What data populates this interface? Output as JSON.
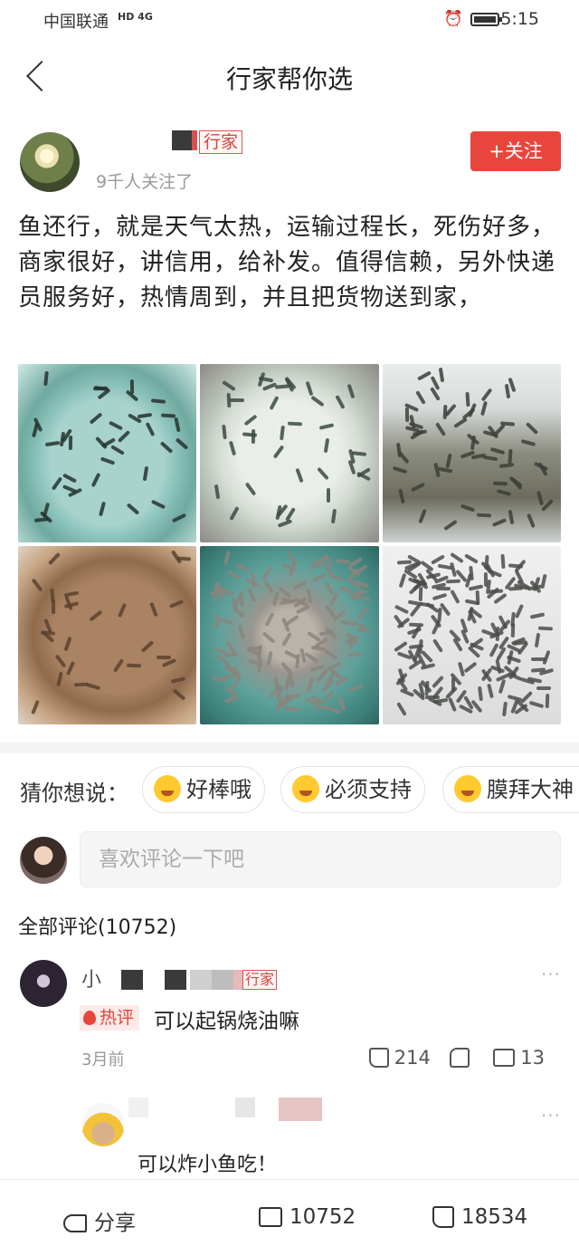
{
  "status_bar": {
    "carrier": "中国联通",
    "network": "HD 4G",
    "time": "5:15"
  },
  "nav": {
    "title": "行家帮你选"
  },
  "author": {
    "badge": "行家",
    "followers": "9千人关注了",
    "follow_label": "+关注"
  },
  "post": {
    "text": "鱼还行，就是天气太热，运输过程长，死伤好多，商家很好，讲信用，给补发。值得信赖，另外快递员服务好，热情周到，并且把货物送到家，"
  },
  "suggestions": {
    "label": "猜你想说：",
    "chips": [
      {
        "label": "好棒哦",
        "icon": "shy-emoji-icon"
      },
      {
        "label": "必须支持",
        "icon": "heart-eyes-emoji-icon"
      },
      {
        "label": "膜拜大神",
        "icon": "awe-emoji-icon"
      }
    ]
  },
  "comment_box": {
    "placeholder": "喜欢评论一下吧"
  },
  "comments_header": "全部评论(10752)",
  "comments": [
    {
      "name_prefix": "小",
      "badge": "行家",
      "hot_label": "热评",
      "text": "可以起锅烧油嘛",
      "time": "3月前",
      "likes": "214",
      "replies": "13",
      "more": "···"
    }
  ],
  "reply": {
    "text": "可以炸小鱼吃！",
    "more": "···"
  },
  "bottom_bar": {
    "share_label": "分享",
    "comments_count": "10752",
    "likes_count": "18534"
  }
}
